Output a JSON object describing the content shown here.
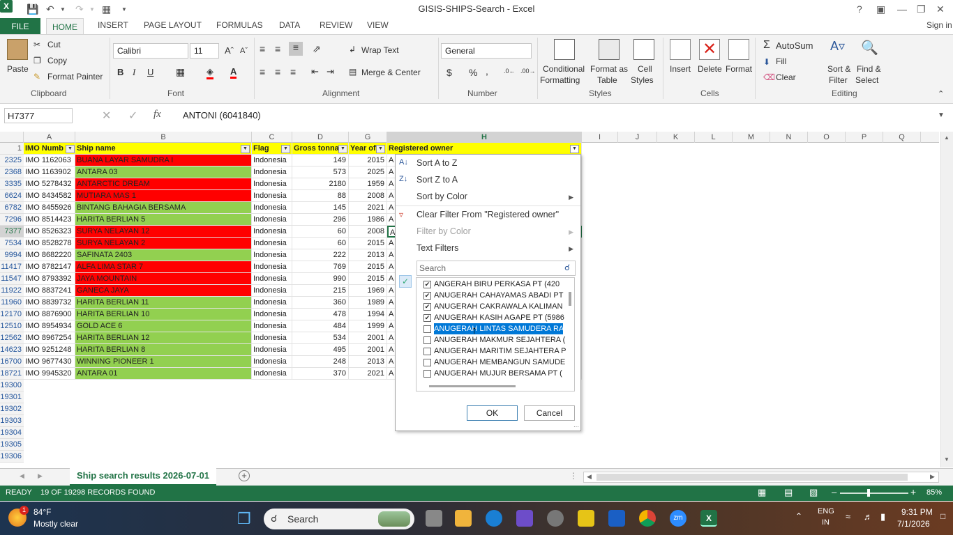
{
  "window": {
    "title": "GISIS-SHIPS-Search - Excel",
    "help": "?",
    "signin": "Sign in"
  },
  "tabs": [
    "FILE",
    "HOME",
    "INSERT",
    "PAGE LAYOUT",
    "FORMULAS",
    "DATA",
    "REVIEW",
    "VIEW"
  ],
  "ribbon": {
    "clipboard": {
      "paste": "Paste",
      "cut": "Cut",
      "copy": "Copy",
      "format_painter": "Format Painter",
      "label": "Clipboard"
    },
    "font": {
      "name": "Calibri",
      "size": "11",
      "bold": "B",
      "italic": "I",
      "underline": "U",
      "label": "Font"
    },
    "alignment": {
      "wrap": "Wrap Text",
      "merge": "Merge & Center",
      "label": "Alignment"
    },
    "number": {
      "format": "General",
      "currency": "$",
      "percent": "%",
      "comma": ",",
      "label": "Number"
    },
    "styles": {
      "conditional": "Conditional",
      "conditional2": "Formatting",
      "format_table": "Format as",
      "format_table2": "Table",
      "cell_styles": "Cell",
      "cell_styles2": "Styles",
      "label": "Styles"
    },
    "cells": {
      "insert": "Insert",
      "delete": "Delete",
      "format": "Format",
      "label": "Cells"
    },
    "editing": {
      "autosum": "AutoSum",
      "fill": "Fill",
      "clear": "Clear",
      "sort": "Sort &",
      "sort2": "Filter",
      "find": "Find &",
      "find2": "Select",
      "label": "Editing"
    }
  },
  "formula_bar": {
    "name_box": "H7377",
    "fx": "fx",
    "content": "ANTONI (6041840)"
  },
  "columns": [
    "A",
    "B",
    "C",
    "D",
    "G",
    "H",
    "I",
    "J",
    "K",
    "L",
    "M",
    "N",
    "O",
    "P",
    "Q"
  ],
  "header_row": {
    "num": "1",
    "a": "IMO Numb",
    "b": "Ship name",
    "c": "Flag",
    "d": "Gross tonnag",
    "g": "Year of",
    "h": "Registered owner"
  },
  "rows": [
    {
      "r": "2325",
      "imo": "IMO 1162063",
      "ship": "BUANA LAYAR SAMUDRA I",
      "flag": "Indonesia",
      "gt": "149",
      "yr": "2015",
      "h": "A",
      "color": "red"
    },
    {
      "r": "2368",
      "imo": "IMO 1163902",
      "ship": "ANTARA 03",
      "flag": "Indonesia",
      "gt": "573",
      "yr": "2025",
      "h": "A",
      "color": "grn"
    },
    {
      "r": "3335",
      "imo": "IMO 5278432",
      "ship": "ANTARCTIC DREAM",
      "flag": "Indonesia",
      "gt": "2180",
      "yr": "1959",
      "h": "A",
      "color": "red"
    },
    {
      "r": "6624",
      "imo": "IMO 8434582",
      "ship": "MUTIARA MAS 1",
      "flag": "Indonesia",
      "gt": "88",
      "yr": "2008",
      "h": "A",
      "color": "red"
    },
    {
      "r": "6782",
      "imo": "IMO 8455926",
      "ship": "BINTANG BAHAGIA BERSAMA",
      "flag": "Indonesia",
      "gt": "145",
      "yr": "2021",
      "h": "A",
      "color": "grn"
    },
    {
      "r": "7296",
      "imo": "IMO 8514423",
      "ship": "HARITA BERLIAN 5",
      "flag": "Indonesia",
      "gt": "296",
      "yr": "1986",
      "h": "A",
      "color": "grn"
    },
    {
      "r": "7377",
      "imo": "IMO 8526323",
      "ship": "SURYA NELAYAN 12",
      "flag": "Indonesia",
      "gt": "60",
      "yr": "2008",
      "h": "A",
      "color": "red"
    },
    {
      "r": "7534",
      "imo": "IMO 8528278",
      "ship": "SURYA NELAYAN 2",
      "flag": "Indonesia",
      "gt": "60",
      "yr": "2015",
      "h": "A",
      "color": "red"
    },
    {
      "r": "9994",
      "imo": "IMO 8682220",
      "ship": "SAFINATA 2403",
      "flag": "Indonesia",
      "gt": "222",
      "yr": "2013",
      "h": "A",
      "color": "grn"
    },
    {
      "r": "11417",
      "imo": "IMO 8782147",
      "ship": "ALFA LIMA STAR 7",
      "flag": "Indonesia",
      "gt": "769",
      "yr": "2015",
      "h": "A",
      "color": "red"
    },
    {
      "r": "11547",
      "imo": "IMO 8793392",
      "ship": "JAYA MOUNTAIN",
      "flag": "Indonesia",
      "gt": "990",
      "yr": "2015",
      "h": "A",
      "color": "red"
    },
    {
      "r": "11922",
      "imo": "IMO 8837241",
      "ship": "GANECA JAYA",
      "flag": "Indonesia",
      "gt": "215",
      "yr": "1969",
      "h": "A",
      "color": "red"
    },
    {
      "r": "11960",
      "imo": "IMO 8839732",
      "ship": "HARITA BERLIAN 11",
      "flag": "Indonesia",
      "gt": "360",
      "yr": "1989",
      "h": "A",
      "color": "grn"
    },
    {
      "r": "12170",
      "imo": "IMO 8876900",
      "ship": "HARITA BERLIAN 10",
      "flag": "Indonesia",
      "gt": "478",
      "yr": "1994",
      "h": "A",
      "color": "grn"
    },
    {
      "r": "12510",
      "imo": "IMO 8954934",
      "ship": "GOLD ACE 6",
      "flag": "Indonesia",
      "gt": "484",
      "yr": "1999",
      "h": "A",
      "color": "grn"
    },
    {
      "r": "12562",
      "imo": "IMO 8967254",
      "ship": "HARITA BERLIAN 12",
      "flag": "Indonesia",
      "gt": "534",
      "yr": "2001",
      "h": "A",
      "color": "grn"
    },
    {
      "r": "14623",
      "imo": "IMO 9251248",
      "ship": "HARITA BERLIAN 8",
      "flag": "Indonesia",
      "gt": "495",
      "yr": "2001",
      "h": "A",
      "color": "grn"
    },
    {
      "r": "16700",
      "imo": "IMO 9677430",
      "ship": "WINNING PIONEER 1",
      "flag": "Indonesia",
      "gt": "248",
      "yr": "2013",
      "h": "A",
      "color": "grn"
    },
    {
      "r": "18721",
      "imo": "IMO 9945320",
      "ship": "ANTARA 01",
      "flag": "Indonesia",
      "gt": "370",
      "yr": "2021",
      "h": "A",
      "color": "grn"
    }
  ],
  "empty_rows": [
    "19300",
    "19301",
    "19302",
    "19303",
    "19304",
    "19305",
    "19306"
  ],
  "filter_menu": {
    "sort_az": "Sort A to Z",
    "sort_za": "Sort Z to A",
    "sort_color": "Sort by Color",
    "clear": "Clear Filter From \"Registered owner\"",
    "filter_color": "Filter by Color",
    "text_filters": "Text Filters",
    "search_placeholder": "Search",
    "items": [
      {
        "label": "ANGERAH BIRU PERKASA PT (420",
        "checked": true
      },
      {
        "label": "ANUGERAH CAHAYAMAS ABADI PT",
        "checked": true
      },
      {
        "label": "ANUGERAH CAKRAWALA KALIMAN",
        "checked": true
      },
      {
        "label": "ANUGERAH KASIH AGAPE PT (5986",
        "checked": true
      },
      {
        "label": "ANUGERAH LINTAS SAMUDERA RA",
        "checked": false
      },
      {
        "label": "ANUGERAH MAKMUR SEJAHTERA (",
        "checked": false
      },
      {
        "label": "ANUGERAH MARITIM SEJAHTERA P",
        "checked": false
      },
      {
        "label": "ANUGERAH MEMBANGUN SAMUDE",
        "checked": false
      },
      {
        "label": "ANUGERAH MUJUR BERSAMA PT (",
        "checked": false
      }
    ],
    "ok": "OK",
    "cancel": "Cancel"
  },
  "sheet_tab": "Ship search results 2026-07-01",
  "status": {
    "ready": "READY",
    "records": "19 OF 19298 RECORDS FOUND",
    "zoom": "85%"
  },
  "taskbar": {
    "temp": "84°F",
    "weather": "Mostly clear",
    "search": "Search",
    "lang": "ENG",
    "region": "IN",
    "time": "9:31 PM",
    "date": "7/1/2026",
    "badge": "1"
  }
}
